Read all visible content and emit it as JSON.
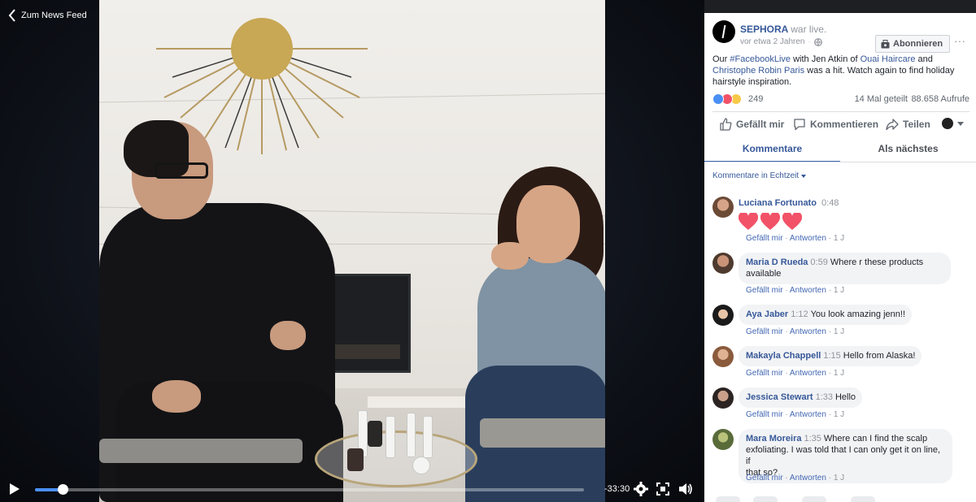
{
  "video": {
    "back_label": "Zum News Feed",
    "time_remaining": "-33:30",
    "progress": 0.05
  },
  "post": {
    "page_name": "SEPHORA",
    "page_name_suffix": "war live.",
    "time": "vor etwa 2 Jahren",
    "subscribe_label": "Abonnieren",
    "text": {
      "t1": "Our ",
      "hashtag": "#FacebookLive",
      "t2": " with Jen Atkin of ",
      "link1": "Ouai Haircare",
      "t3": " and ",
      "link2": "Christophe Robin Paris",
      "t4": " was a hit. Watch again to find holiday hairstyle inspiration."
    },
    "reactions_count": "249",
    "shares": "14 Mal geteilt",
    "views": "88.658 Aufrufe",
    "reaction_icons": [
      "like-icon",
      "love-icon",
      "haha-icon"
    ]
  },
  "actions": {
    "like": "Gefällt mir",
    "comment": "Kommentieren",
    "share": "Teilen"
  },
  "tabs": {
    "comments": "Kommentare",
    "up_next": "Als nächstes"
  },
  "filter_label": "Kommentare in Echtzeit",
  "comment_actions": {
    "like": "Gefällt mir",
    "reply": "Antworten",
    "sep": " · "
  },
  "comments": [
    {
      "name": "Luciana Fortunato",
      "timestamp": "0:48",
      "text": "",
      "age": "1 J",
      "hearts": 3
    },
    {
      "name": "Maria D Rueda",
      "timestamp": "0:59",
      "text": "Where r these products",
      "text2": "available",
      "age": "1 J"
    },
    {
      "name": "Aya Jaber",
      "timestamp": "1:12",
      "text": "You look amazing jenn!!",
      "age": "1 J"
    },
    {
      "name": "Makayla Chappell",
      "timestamp": "1:15",
      "text": "Hello from Alaska!",
      "age": "1 J"
    },
    {
      "name": "Jessica Stewart",
      "timestamp": "1:33",
      "text": "Hello",
      "age": "1 J"
    },
    {
      "name": "Mara Moreira",
      "timestamp": "1:35",
      "text": "Where can I find the scalp",
      "text2": "exfoliating. I was told that I can only get it on line, if",
      "text3": "that so?",
      "age": "1 J"
    }
  ],
  "colors": {
    "link": "#365899",
    "accent": "#4267b2",
    "progress": "#4a8ff5",
    "heart": "#f25268"
  }
}
